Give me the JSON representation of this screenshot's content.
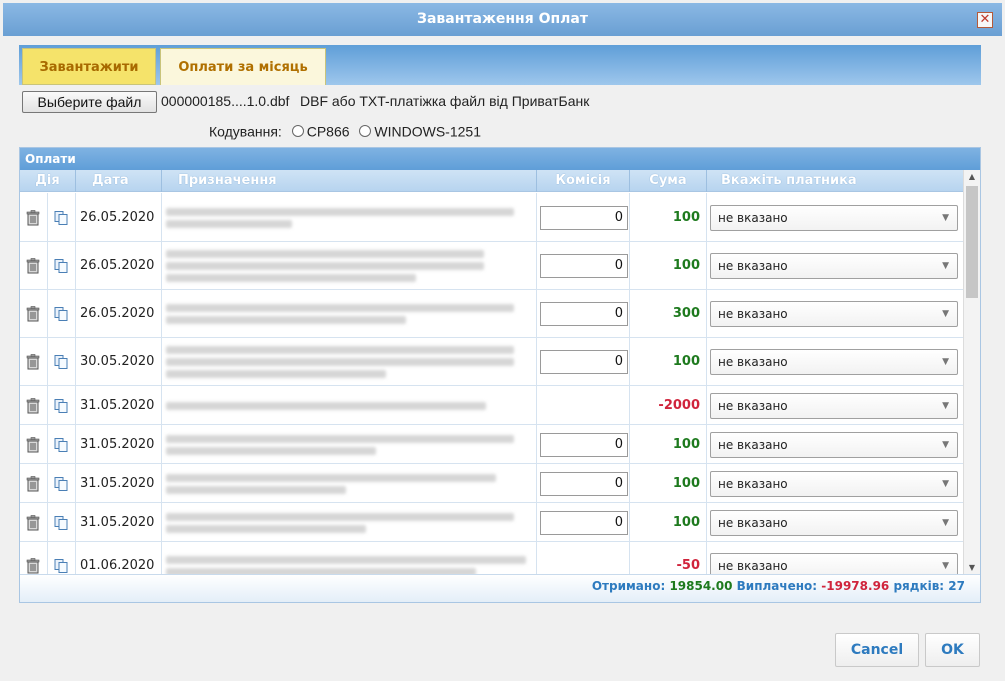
{
  "dialog": {
    "title": "Завантаження Оплат"
  },
  "tabs": [
    {
      "label": "Завантажити"
    },
    {
      "label": "Оплати за місяць"
    }
  ],
  "file": {
    "button_label": "Выберите файл",
    "selected_name": "000000185....1.0.dbf",
    "hint": "DBF або TXT-платіжка файл від ПриватБанк"
  },
  "encoding": {
    "label": "Кодування:",
    "options": [
      "CP866",
      "WINDOWS-1251"
    ]
  },
  "grid": {
    "title": "Оплати",
    "columns": {
      "action": "Дія",
      "date": "Дата",
      "purpose": "Призначення",
      "commission": "Комісія",
      "sum": "Сума",
      "payer": "Вкажіть платника"
    },
    "rows": [
      {
        "date": "26.05.2020",
        "commission": "0",
        "sum": "100",
        "payer": "не вказано"
      },
      {
        "date": "26.05.2020",
        "commission": "0",
        "sum": "100",
        "payer": "не вказано"
      },
      {
        "date": "26.05.2020",
        "commission": "0",
        "sum": "300",
        "payer": "не вказано"
      },
      {
        "date": "30.05.2020",
        "commission": "0",
        "sum": "100",
        "payer": "не вказано"
      },
      {
        "date": "31.05.2020",
        "commission": "",
        "sum": "-2000",
        "payer": "не вказано"
      },
      {
        "date": "31.05.2020",
        "commission": "0",
        "sum": "100",
        "payer": "не вказано"
      },
      {
        "date": "31.05.2020",
        "commission": "0",
        "sum": "100",
        "payer": "не вказано"
      },
      {
        "date": "31.05.2020",
        "commission": "0",
        "sum": "100",
        "payer": "не вказано"
      },
      {
        "date": "01.06.2020",
        "commission": "",
        "sum": "-50",
        "payer": "не вказано"
      }
    ]
  },
  "footer": {
    "received_label": "Отримано:",
    "received_value": "19854.00",
    "paid_label": "Виплачено:",
    "paid_value": "-19978.96",
    "rows_label": "рядків:",
    "rows_value": "27"
  },
  "buttons": {
    "cancel": "Cancel",
    "ok": "OK"
  },
  "colors": {
    "positive": "#1e7a1e",
    "negative": "#d0243c",
    "accent": "#2e7bbf"
  },
  "icons": {
    "row_delete": "trash-icon",
    "row_copy": "copy-icon",
    "close": "close-icon"
  }
}
